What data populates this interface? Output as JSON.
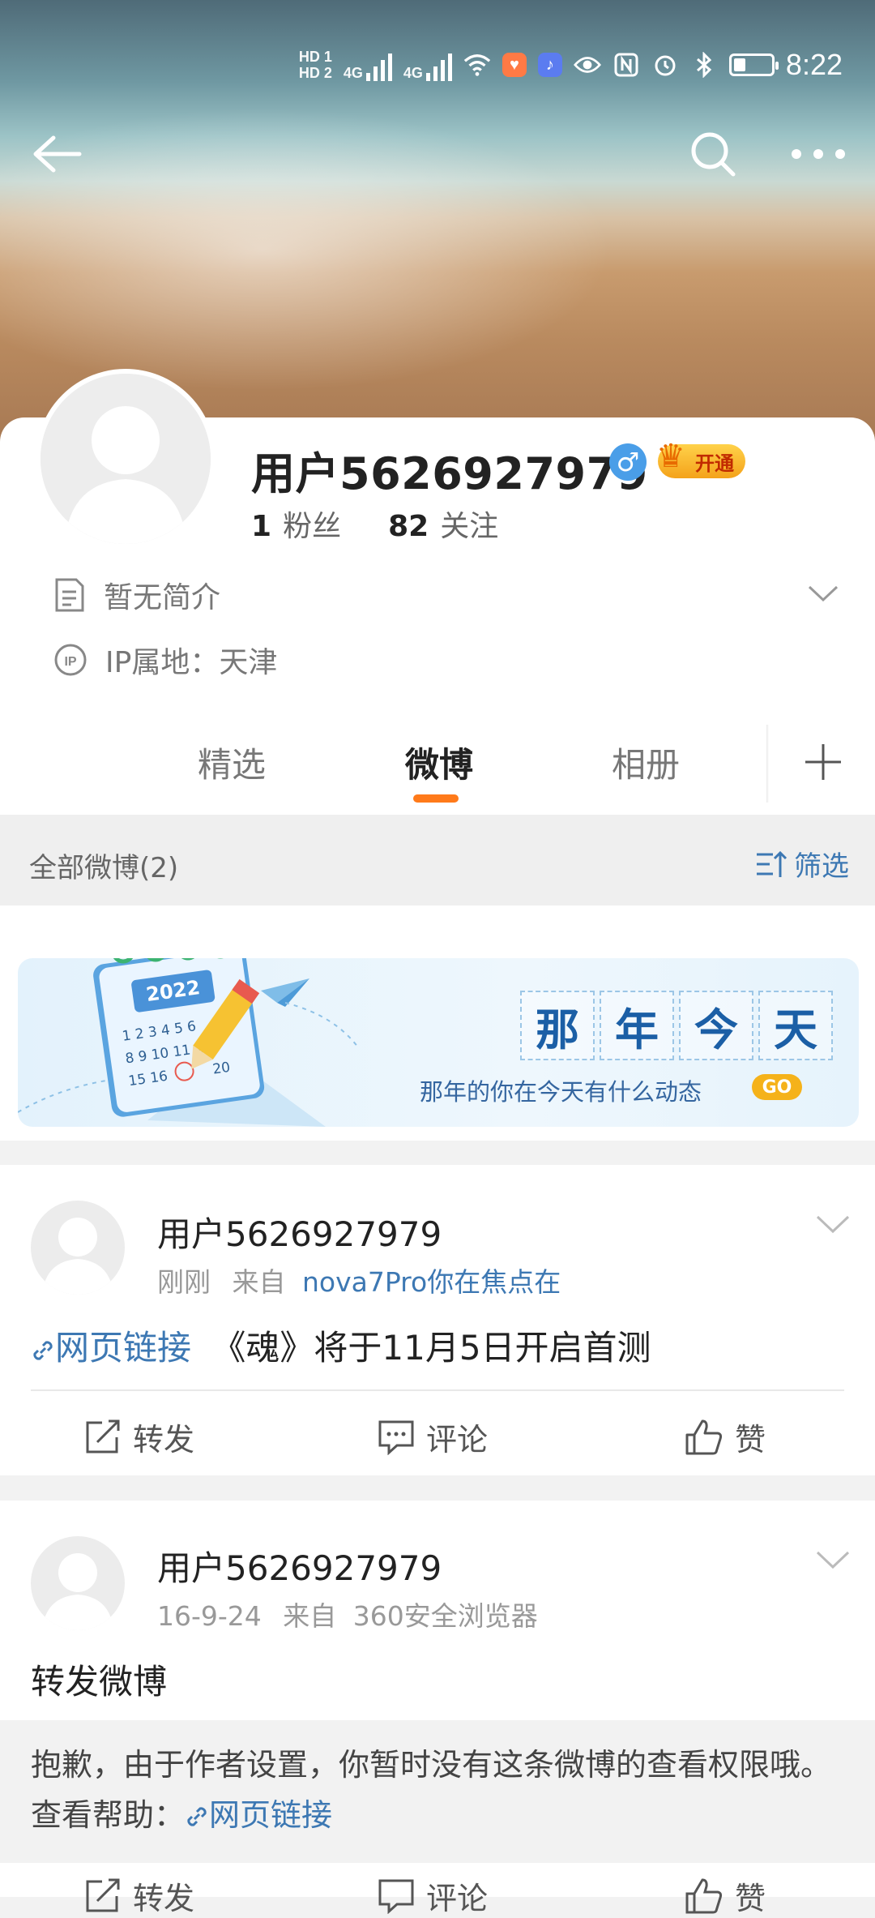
{
  "status_bar": {
    "hd1": "HD 1",
    "hd2": "HD 2",
    "net1": "4G",
    "net2": "4G",
    "time": "8:22"
  },
  "profile": {
    "username": "用户5626927979",
    "vip_label": "开通",
    "fans_count": "1",
    "fans_label": "粉丝",
    "following_count": "82",
    "following_label": "关注",
    "bio": "暂无简介",
    "ip_location": "IP属地：天津"
  },
  "tabs": [
    {
      "label": "精选"
    },
    {
      "label": "微博"
    },
    {
      "label": "相册"
    }
  ],
  "filter_bar": {
    "all_label": "全部微博(2)",
    "filter_label": "筛选"
  },
  "promo": {
    "calendar_year": "2022",
    "calendar_numbers": "1 2 3 4 5 6",
    "calendar_numbers2": "8 9 10 11 12",
    "calendar_numbers3": "15 16",
    "calendar_numbers4": "20",
    "title_chars": [
      "那",
      "年",
      "今",
      "天"
    ],
    "subtitle": "那年的你在今天有什么动态",
    "go": "GO"
  },
  "posts": [
    {
      "author": "用户5626927979",
      "time": "刚刚",
      "from_prefix": "来自",
      "source": "nova7Pro你在焦点在",
      "link_label": "网页链接",
      "text": "《魂》将于11月5日开启首测",
      "actions": {
        "repost": "转发",
        "comment": "评论",
        "like": "赞"
      }
    },
    {
      "author": "用户5626927979",
      "time": "16-9-24",
      "from_prefix": "来自",
      "source": "360安全浏览器",
      "text": "转发微博",
      "quote_text": "抱歉，由于作者设置，你暂时没有这条微博的查看权限哦。查看帮助：",
      "quote_link": "网页链接",
      "actions": {
        "repost": "转发",
        "comment": "评论",
        "like": "赞"
      }
    }
  ],
  "colors": {
    "accent_orange": "#ff7a1a",
    "link_blue": "#3d78b3"
  }
}
